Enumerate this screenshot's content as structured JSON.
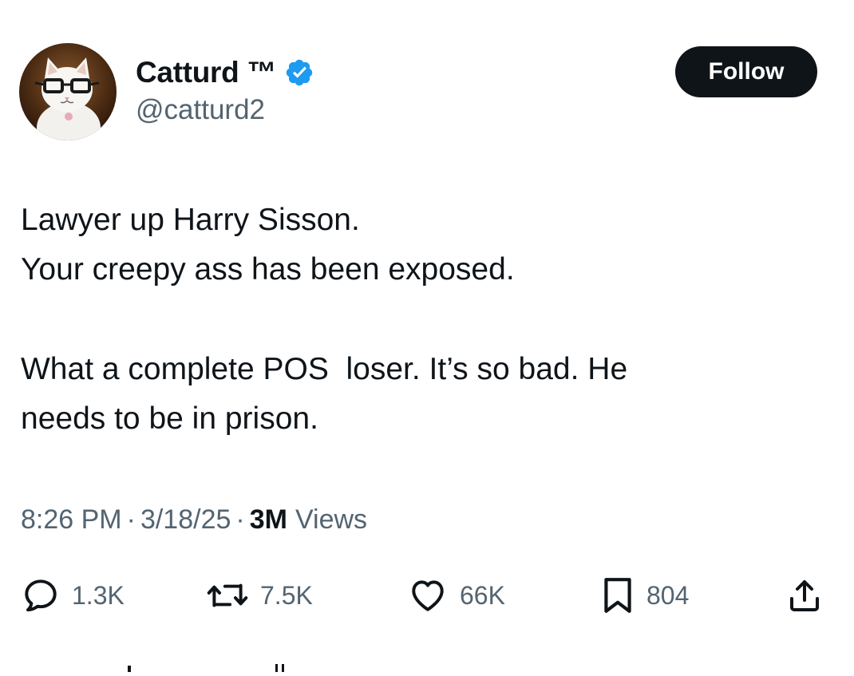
{
  "user": {
    "display_name": "Catturd ™",
    "handle": "@catturd2",
    "verified": true,
    "avatar_icon": "cat-with-glasses-avatar"
  },
  "follow_button": {
    "label": "Follow"
  },
  "tweet": {
    "lines": [
      "Lawyer up Harry Sisson.",
      "Your creepy ass has been exposed.",
      "What a complete POS  loser. It’s so bad. He",
      "needs to be in prison."
    ]
  },
  "meta": {
    "time": "8:26 PM",
    "separator": "·",
    "date": "3/18/25",
    "views_count": "3M",
    "views_label": "Views"
  },
  "actions": {
    "reply": {
      "icon": "reply-icon",
      "count": "1.3K"
    },
    "repost": {
      "icon": "repost-icon",
      "count": "7.5K"
    },
    "like": {
      "icon": "like-icon",
      "count": "66K"
    },
    "bookmark": {
      "icon": "bookmark-icon",
      "count": "804"
    },
    "share": {
      "icon": "share-icon"
    }
  },
  "colors": {
    "text": "#0f1419",
    "secondary": "#536471",
    "verified": "#1d9bf0",
    "button_bg": "#0f1419"
  }
}
